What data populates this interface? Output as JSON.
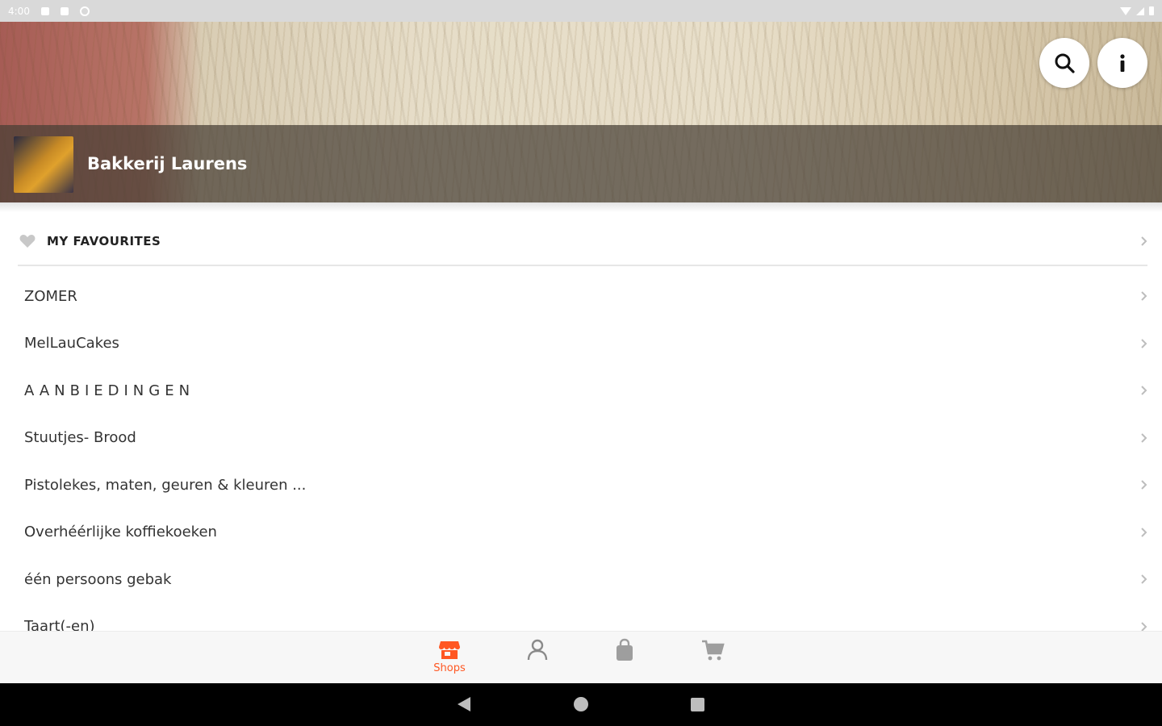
{
  "status_bar": {
    "time": "4:00"
  },
  "header": {
    "shop_name": "Bakkerij Laurens",
    "search_icon": "search-icon",
    "info_icon": "info-icon"
  },
  "favourites": {
    "label": "MY FAVOURITES",
    "icon": "heart-icon"
  },
  "categories": [
    {
      "label": "ZOMER"
    },
    {
      "label": "MelLauCakes"
    },
    {
      "label": "AANBIEDINGEN"
    },
    {
      "label": "Stuutjes- Brood"
    },
    {
      "label": "Pistolekes, maten, geuren & kleuren ..."
    },
    {
      "label": "Overhéérlijke koffiekoeken"
    },
    {
      "label": "één persoons gebak"
    },
    {
      "label": "Taart(-en)"
    }
  ],
  "bottom_nav": {
    "shops_label": "Shops",
    "accent_color": "#ff5722",
    "inactive_color": "#9e9e9e"
  }
}
